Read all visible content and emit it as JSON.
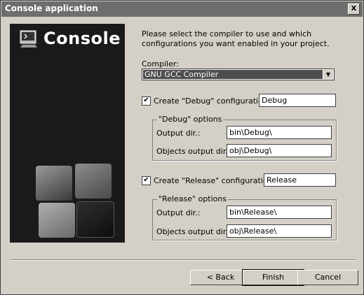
{
  "window": {
    "title": "Console application",
    "close_glyph": "X"
  },
  "banner": {
    "text": "Console",
    "icon": "console-app-icon"
  },
  "intro": "Please select the compiler to use and which configurations you want enabled in your project.",
  "compiler": {
    "label": "Compiler:",
    "value": "GNU GCC Compiler"
  },
  "debug": {
    "checkbox_label": "Create \"Debug\" configuration:",
    "checked": true,
    "name_value": "Debug",
    "group_title": "\"Debug\" options",
    "output_dir_label": "Output dir.:",
    "output_dir_value": "bin\\Debug\\",
    "objects_dir_label": "Objects output dir.:",
    "objects_dir_value": "obj\\Debug\\"
  },
  "release": {
    "checkbox_label": "Create \"Release\" configuration:",
    "checked": true,
    "name_value": "Release",
    "group_title": "\"Release\" options",
    "output_dir_label": "Output dir.:",
    "output_dir_value": "bin\\Release\\",
    "objects_dir_label": "Objects output dir.:",
    "objects_dir_value": "obj\\Release\\"
  },
  "buttons": {
    "back": "< Back",
    "finish": "Finish",
    "cancel": "Cancel"
  },
  "colors": {
    "title_bar": "#6e6e6e",
    "dialog_bg": "#d4d0c8",
    "side_panel": "#1a1a1a",
    "selection": "#4d4d4d"
  }
}
